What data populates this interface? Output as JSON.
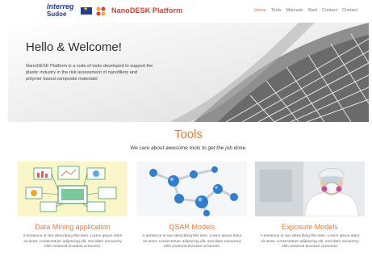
{
  "header": {
    "logo_line1": "Interreg",
    "logo_line2": "Sudoe",
    "brand": "NanoDESK Platform",
    "nav": [
      "Home",
      "Tools",
      "Manuals",
      "Start",
      "Contact",
      "Contact"
    ]
  },
  "hero": {
    "title": "Hello & Welcome!",
    "text": "NanoDESK Platform is a suite of tools developed to support the plastic industry in the risk assessment of nanofillers and polymer based composite materials!"
  },
  "tools": {
    "title": "Tools",
    "subtitle": "We care about awesome tools to get the job done.",
    "cards": [
      {
        "title": "Data Mining application",
        "desc": "A sentence or two describing this item. Lorem ipsum dolor sit amet, consectetuer adipiscing elit, sed diam nonummy nibh euismod tincidunt ut laoreet."
      },
      {
        "title": "QSAR Models",
        "desc": "A sentence or two describing this item. Lorem ipsum dolor sit amet, consectetuer adipiscing elit, sed diam nonummy nibh euismod tincidunt ut laoreet."
      },
      {
        "title": "Exposure Models",
        "desc": "A sentence or two describing this item. Lorem ipsum dolor sit amet, consectetuer adipiscing elit, sed diam nonummy nibh euismod tincidunt ut laoreet."
      }
    ]
  },
  "colors": {
    "accent": "#f07a2b",
    "brand": "#e03a2e",
    "interreg_blue": "#223a8f"
  }
}
